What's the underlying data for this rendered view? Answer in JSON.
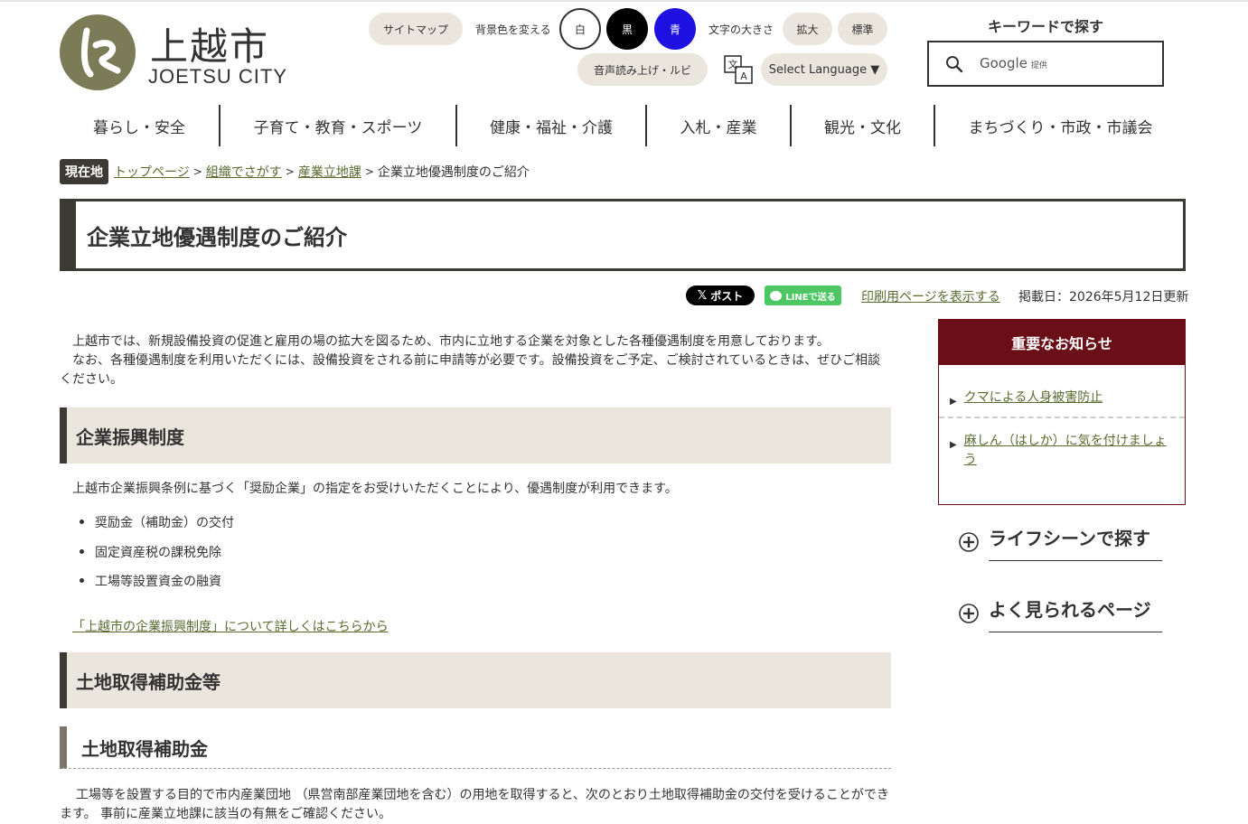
{
  "header": {
    "logo_kanji": "上越市",
    "logo_en": "JOETSU CITY",
    "sitemap": "サイトマップ",
    "bg_color_label": "背景色を変える",
    "bg_white": "白",
    "bg_black": "黒",
    "bg_blue": "青",
    "text_size_label": "文字の大きさ",
    "text_enlarge": "拡大",
    "text_standard": "標準",
    "read_aloud": "音声読み上げ・ルビ",
    "select_language": "Select Language ▼",
    "keyword_title": "キーワードで探す",
    "google_label": "Google",
    "google_provided": "提供"
  },
  "nav": [
    {
      "label": "暮らし・安全"
    },
    {
      "label": "子育て・教育・スポーツ"
    },
    {
      "label": "健康・福祉・介護"
    },
    {
      "label": "入札・産業"
    },
    {
      "label": "観光・文化"
    },
    {
      "label": "まちづくり・市政・市議会"
    }
  ],
  "breadcrumb": {
    "here": "現在地",
    "items": [
      "トップページ",
      "組織でさがす",
      "産業立地課"
    ],
    "current": "企業立地優遇制度のご紹介"
  },
  "page": {
    "title": "企業立地優遇制度のご紹介",
    "share_x": "ポスト",
    "share_line": "LINEで送る",
    "print_link": "印刷用ページを表示する",
    "updated": "掲載日：2026年5月12日更新"
  },
  "content": {
    "intro_1": "上越市では、新規設備投資の促進と雇用の場の拡大を図るため、市内に立地する企業を対象とした各種優遇制度を用意しております。",
    "intro_2": "なお、各種優遇制度を利用いただくには、設備投資をされる前に申請等が必要です。設備投資をご予定、ご検討されているときは、ぜひご相談ください。",
    "section1_title": "企業振興制度",
    "section1_text": "上越市企業振興条例に基づく「奨励企業」の指定をお受けいただくことにより、優遇制度が利用できます。",
    "section1_bullets": [
      "奨励金（補助金）の交付",
      "固定資産税の課税免除",
      "工場等設置資金の融資"
    ],
    "section1_link": "「上越市の企業振興制度」について詳しくはこちらから",
    "section2_title": "土地取得補助金等",
    "section2_sub": "土地取得補助金",
    "section2_text": "工場等を設置する目的で市内産業団地 （県営南部産業団地を含む）の用地を取得すると、次のとおり土地取得補助金の交付を受けることができます。 事前に産業立地課に該当の有無をご確認ください。"
  },
  "sidebar": {
    "notice_title": "重要なお知らせ",
    "notices": [
      "クマによる人身被害防止",
      "麻しん（はしか）に気を付けましょう"
    ],
    "life_scene": "ライフシーンで探す",
    "popular": "よく見られるページ"
  },
  "colors": {
    "brand_olive": "#7c7b58",
    "beige": "#ebe6dd",
    "dark": "#3d3a36",
    "notice_red": "#6a0f17",
    "link_green": "#5a6b2f",
    "bg_blue": "#1e10e0"
  }
}
